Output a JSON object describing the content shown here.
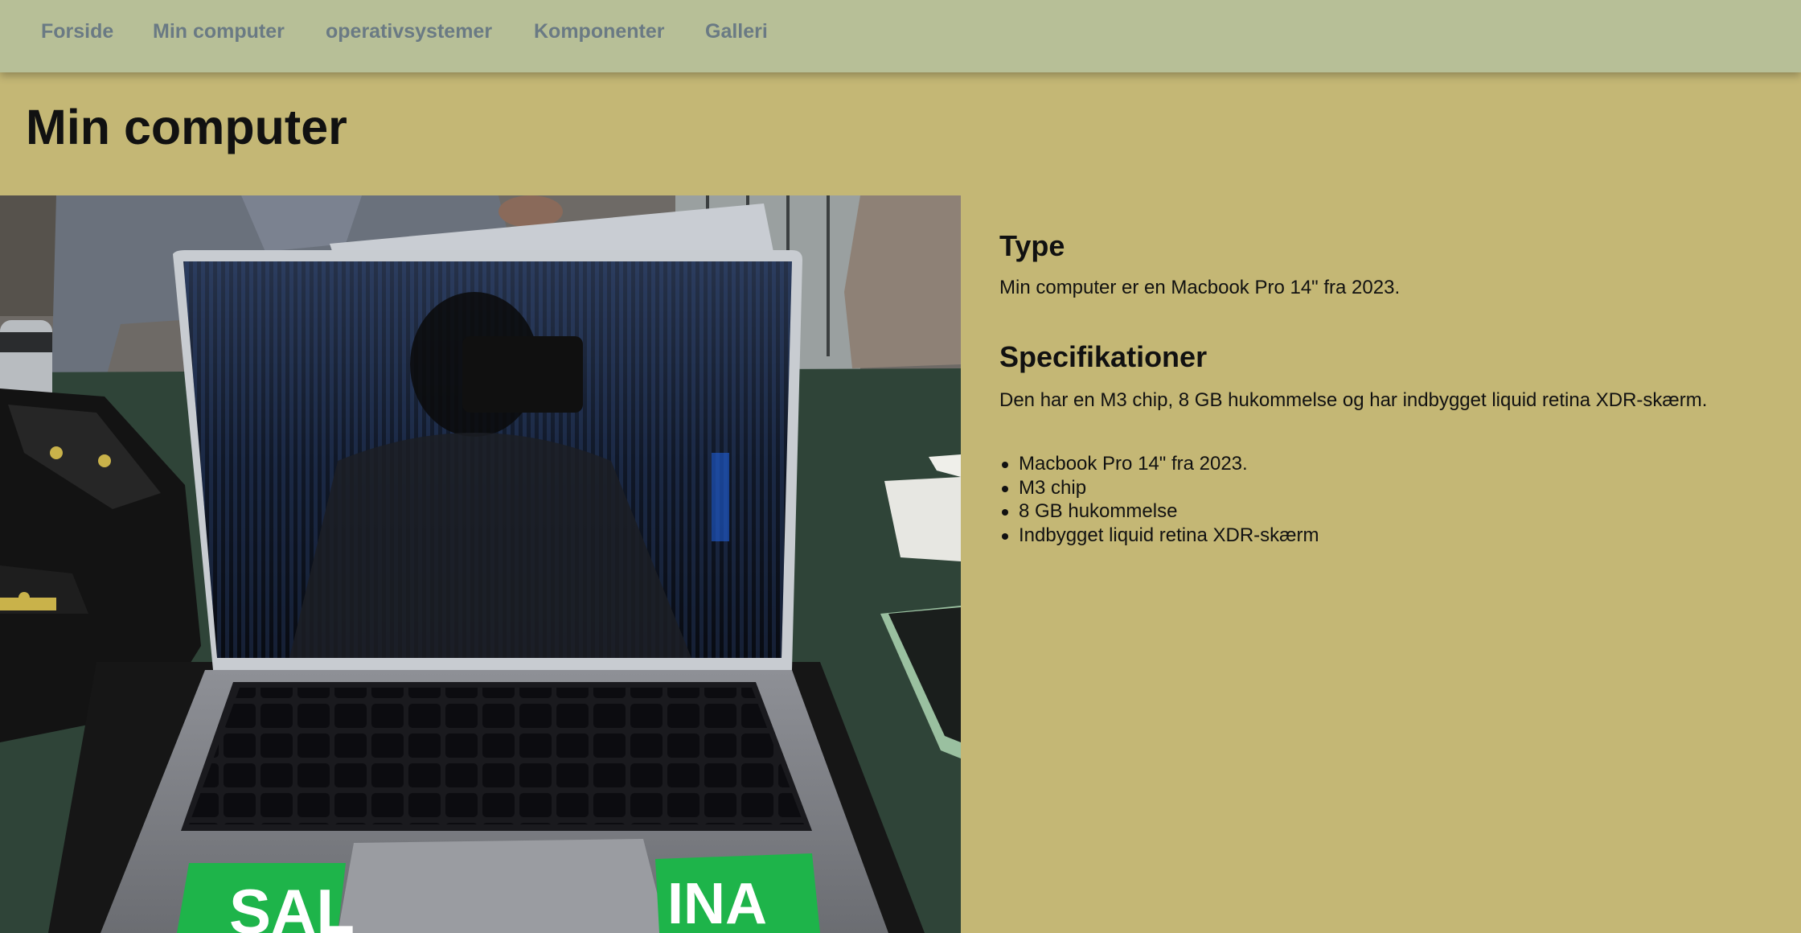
{
  "nav": {
    "items": [
      {
        "label": "Forside"
      },
      {
        "label": "Min computer"
      },
      {
        "label": "operativsystemer"
      },
      {
        "label": "Komponenter"
      },
      {
        "label": "Galleri"
      }
    ]
  },
  "page": {
    "title": "Min computer"
  },
  "photo": {
    "sticker_left_text": "SAL",
    "sticker_right_text": "INA"
  },
  "sections": {
    "type": {
      "heading": "Type",
      "text": "Min computer er en Macbook Pro 14\" fra 2023."
    },
    "specs": {
      "heading": "Specifikationer",
      "text": "Den har en M3 chip, 8 GB hukommelse og har indbygget liquid retina XDR-skærm.",
      "items": [
        "Macbook Pro 14\" fra 2023.",
        "M3 chip",
        "8 GB hukommelse",
        "Indbygget liquid retina XDR-skærm"
      ]
    }
  },
  "colors": {
    "page_background": "#c4b775",
    "navbar_background": "#b7bf97",
    "nav_link": "#6a7a84",
    "text": "#111111"
  }
}
